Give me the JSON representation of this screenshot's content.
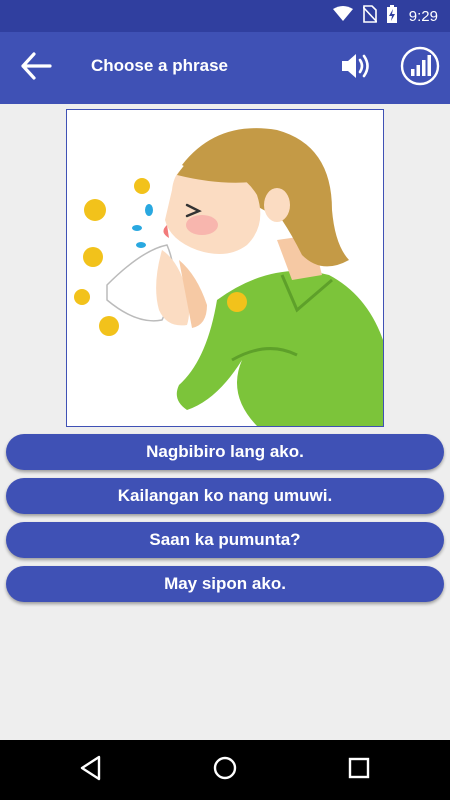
{
  "status_bar": {
    "time": "9:29",
    "icons": [
      "wifi-icon",
      "no-sim-icon",
      "battery-charging-icon"
    ]
  },
  "app_bar": {
    "title": "Choose a phrase",
    "back_icon": "back-arrow-icon",
    "sound_icon": "speaker-icon",
    "stats_icon": "bar-chart-icon"
  },
  "picture": {
    "description_icon": "sneezing-woman-illustration"
  },
  "options": [
    {
      "label": "Nagbibiro lang ako."
    },
    {
      "label": "Kailangan ko nang umuwi."
    },
    {
      "label": "Saan ka pumunta?"
    },
    {
      "label": "May sipon ako."
    }
  ],
  "nav_bar": {
    "icons": [
      "back-triangle-icon",
      "home-circle-icon",
      "recents-square-icon"
    ]
  },
  "colors": {
    "primary": "#3f51b5",
    "primary_dark": "#303f9f",
    "background": "#eeeeee"
  }
}
